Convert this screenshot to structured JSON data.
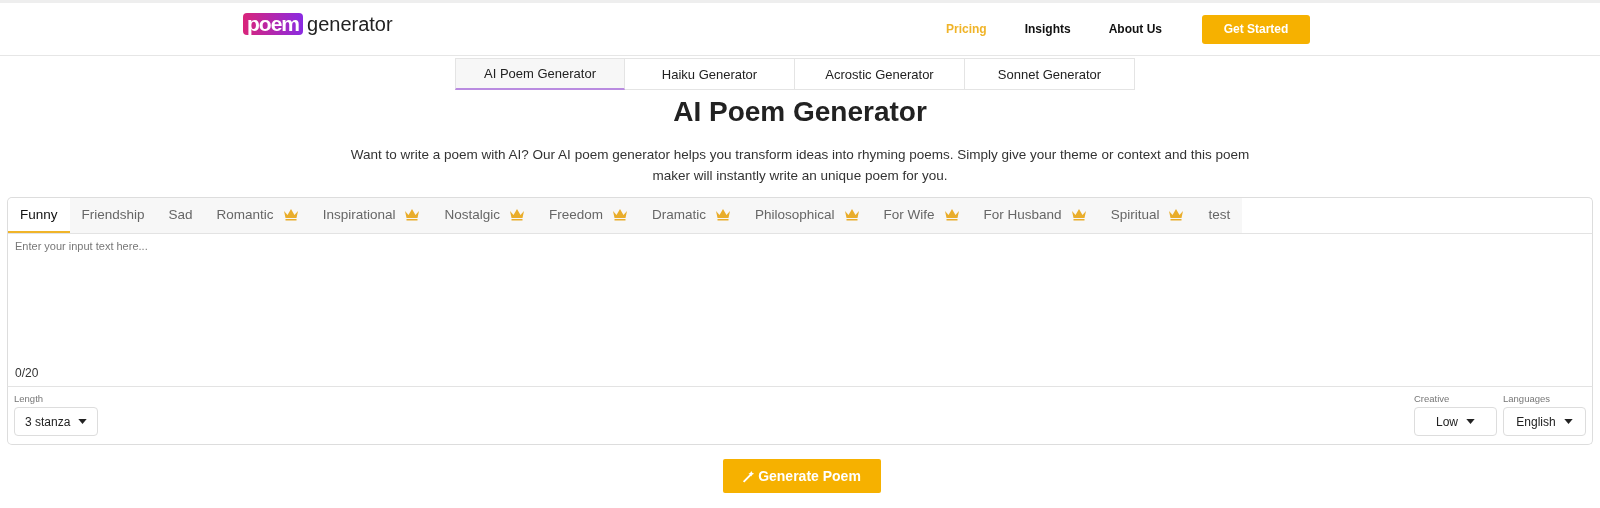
{
  "logo": {
    "badge": "poem",
    "word": "generator"
  },
  "nav": [
    {
      "label": "Pricing",
      "selected": true
    },
    {
      "label": "Insights",
      "selected": false
    },
    {
      "label": "About Us",
      "selected": false
    }
  ],
  "cta": "Get Started",
  "tool_tabs": [
    {
      "label": "AI Poem Generator",
      "selected": true
    },
    {
      "label": "Haiku Generator",
      "selected": false
    },
    {
      "label": "Acrostic Generator",
      "selected": false
    },
    {
      "label": "Sonnet Generator",
      "selected": false
    }
  ],
  "title": "AI Poem Generator",
  "description": "Want to write a poem with AI? Our AI poem generator helps you transform ideas into rhyming poems. Simply give your theme or context and this poem maker will instantly write an unique poem for you.",
  "categories": [
    {
      "label": "Funny",
      "selected": true,
      "premium": false
    },
    {
      "label": "Friendship",
      "selected": false,
      "premium": false
    },
    {
      "label": "Sad",
      "selected": false,
      "premium": false
    },
    {
      "label": "Romantic",
      "selected": false,
      "premium": true
    },
    {
      "label": "Inspirational",
      "selected": false,
      "premium": true
    },
    {
      "label": "Nostalgic",
      "selected": false,
      "premium": true
    },
    {
      "label": "Freedom",
      "selected": false,
      "premium": true
    },
    {
      "label": "Dramatic",
      "selected": false,
      "premium": true
    },
    {
      "label": "Philosophical",
      "selected": false,
      "premium": true
    },
    {
      "label": "For Wife",
      "selected": false,
      "premium": true
    },
    {
      "label": "For Husband",
      "selected": false,
      "premium": true
    },
    {
      "label": "Spiritual",
      "selected": false,
      "premium": true
    },
    {
      "label": "test",
      "selected": false,
      "premium": false
    }
  ],
  "input": {
    "placeholder": "Enter your input text here...",
    "counter": "0/20"
  },
  "length": {
    "label": "Length",
    "value": "3 stanza"
  },
  "creative": {
    "label": "Creative",
    "value": "Low"
  },
  "languages": {
    "label": "Languages",
    "value": "English"
  },
  "generate": "Generate Poem"
}
